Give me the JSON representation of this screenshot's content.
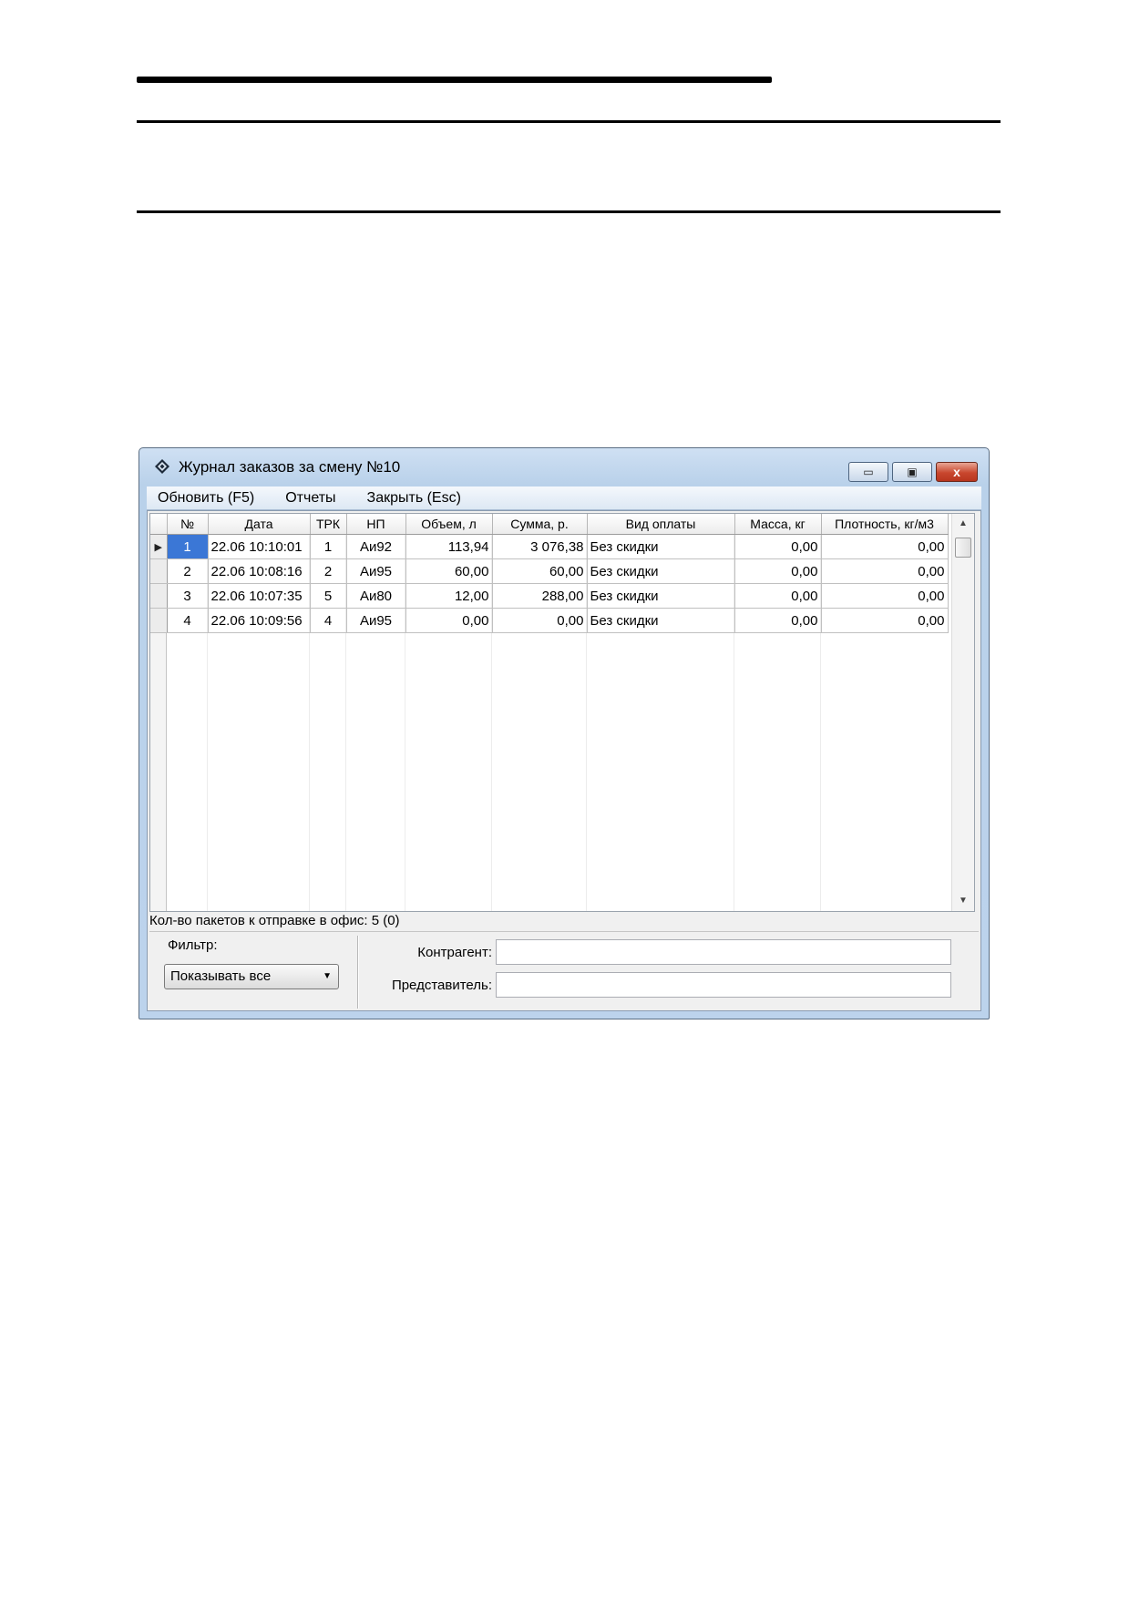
{
  "window": {
    "title": "Журнал заказов за смену №10",
    "close_glyph": "x",
    "min_glyph": "▭",
    "max_glyph": "▣"
  },
  "menu": {
    "items": [
      "Обновить (F5)",
      "Отчеты",
      "Закрыть (Esc)"
    ]
  },
  "table": {
    "columns": [
      "№",
      "Дата",
      "ТРК",
      "НП",
      "Объем, л",
      "Сумма, р.",
      "Вид оплаты",
      "Масса, кг",
      "Плотность, кг/м3"
    ],
    "rows": [
      [
        "1",
        "22.06 10:10:01",
        "1",
        "Аи92",
        "113,94",
        "3 076,38",
        "Без скидки",
        "0,00",
        "0,00"
      ],
      [
        "2",
        "22.06 10:08:16",
        "2",
        "Аи95",
        "60,00",
        "60,00",
        "Без скидки",
        "0,00",
        "0,00"
      ],
      [
        "3",
        "22.06 10:07:35",
        "5",
        "Аи80",
        "12,00",
        "288,00",
        "Без скидки",
        "0,00",
        "0,00"
      ],
      [
        "4",
        "22.06 10:09:56",
        "4",
        "Аи95",
        "0,00",
        "0,00",
        "Без скидки",
        "0,00",
        "0,00"
      ]
    ],
    "selected_row_indicator": "▶"
  },
  "status": {
    "packets_text": "Кол-во пакетов к отправке в офис: 5 (0)"
  },
  "filter": {
    "label": "Фильтр:",
    "selected": "Показывать все"
  },
  "fields": {
    "counterparty_label": "Контрагент:",
    "counterparty_value": "",
    "representative_label": "Представитель:",
    "representative_value": ""
  },
  "colors": {
    "selection": "#3b77d6",
    "titlebar": "#bcd3ec",
    "close_button": "#c9472e"
  }
}
